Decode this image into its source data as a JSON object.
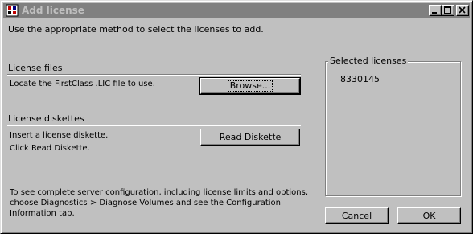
{
  "window": {
    "title": "Add license",
    "icon": "firstclass-app-icon"
  },
  "intro": "Use the appropriate method to select the licenses to add.",
  "license_files": {
    "heading": "License files",
    "instruction": "Locate the FirstClass .LIC file to use.",
    "browse_label": "Browse..."
  },
  "license_diskettes": {
    "heading": "License diskettes",
    "instruction_1": "Insert a license diskette.",
    "instruction_2": "Click Read Diskette.",
    "read_label": "Read Diskette"
  },
  "footer_note": {
    "line_1": "To see complete server configuration, including license limits and options,",
    "line_2": "choose Diagnostics > Diagnose Volumes and see the Configuration",
    "line_3": "Information tab."
  },
  "selected": {
    "title": "Selected licenses",
    "items": [
      "8330145"
    ]
  },
  "actions": {
    "cancel_label": "Cancel",
    "ok_label": "OK"
  }
}
